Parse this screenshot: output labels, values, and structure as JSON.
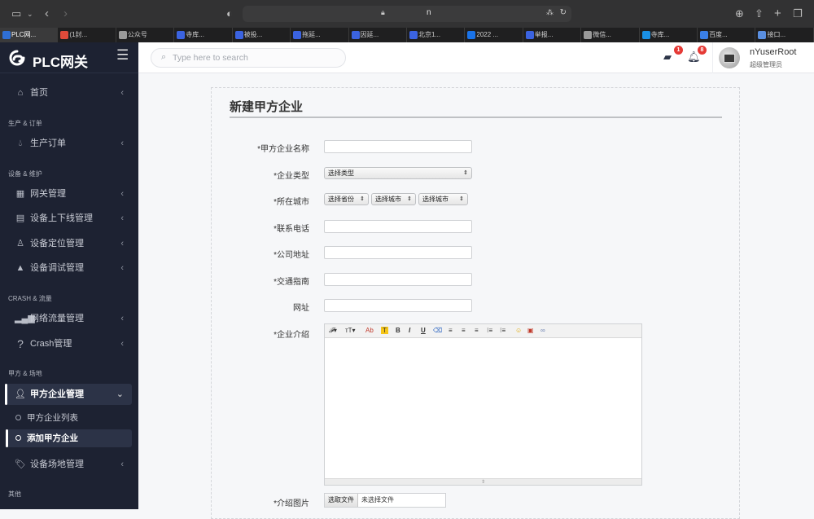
{
  "browser": {
    "url_text": "n",
    "tabs": [
      {
        "label": "PLC网...",
        "color": "#2f6fd6",
        "active": true
      },
      {
        "label": "(1封...",
        "color": "#e04a3a"
      },
      {
        "label": "公众号",
        "color": "#9a9a9a"
      },
      {
        "label": "寺库...",
        "color": "#3b63e0"
      },
      {
        "label": "被投...",
        "color": "#3b63e0"
      },
      {
        "label": "拖延...",
        "color": "#3b63e0"
      },
      {
        "label": "因延...",
        "color": "#3b63e0"
      },
      {
        "label": "北京1...",
        "color": "#3b63e0"
      },
      {
        "label": "2022 ...",
        "color": "#1a73e8"
      },
      {
        "label": "举报...",
        "color": "#3b63e0"
      },
      {
        "label": "微信...",
        "color": "#9a9a9a"
      },
      {
        "label": "寺库...",
        "color": "#1a8fe3"
      },
      {
        "label": "百度...",
        "color": "#3a7fe6"
      },
      {
        "label": "接口...",
        "color": "#5a8fe0"
      }
    ]
  },
  "sidebar": {
    "brand": "PLC网关",
    "sections": [
      {
        "title": "生产 & 订单"
      },
      {
        "title": "设备 & 维护"
      },
      {
        "title": "CRASH & 流量"
      },
      {
        "title": "甲方 & 场地"
      },
      {
        "title": "其他"
      }
    ],
    "items": [
      {
        "label": "首页",
        "icon": "home-icon"
      },
      {
        "label": "生产订单",
        "icon": "droplet-icon"
      },
      {
        "label": "网关管理",
        "icon": "grid-icon"
      },
      {
        "label": "设备上下线管理",
        "icon": "device-icon"
      },
      {
        "label": "设备定位管理",
        "icon": "location-user-icon"
      },
      {
        "label": "设备调试管理",
        "icon": "warning-icon"
      },
      {
        "label": "网络流量管理",
        "icon": "signal-bars-icon"
      },
      {
        "label": "Crash管理",
        "icon": "question-icon"
      },
      {
        "label": "甲方企业管理",
        "icon": "user-list-icon"
      },
      {
        "label": "设备场地管理",
        "icon": "tag-icon"
      }
    ],
    "sub_items": [
      {
        "label": "甲方企业列表"
      },
      {
        "label": "添加甲方企业",
        "active": true
      }
    ]
  },
  "topbar": {
    "search_placeholder": "Type here to search",
    "messages_count": "1",
    "notifications_count": "8",
    "user_name": "nYuserRoot",
    "user_role": "超级管理员"
  },
  "form": {
    "title": "新建甲方企业",
    "fields": {
      "name": {
        "label": "*甲方企业名称",
        "value": ""
      },
      "type": {
        "label": "*企业类型",
        "selected": "选择类型"
      },
      "city": {
        "label": "*所在城市",
        "province": "选择省份",
        "city": "选择城市",
        "district": "选择城市"
      },
      "phone": {
        "label": "*联系电话",
        "value": ""
      },
      "address": {
        "label": "*公司地址",
        "value": ""
      },
      "traffic": {
        "label": "*交通指南",
        "value": ""
      },
      "website": {
        "label": "网址",
        "value": ""
      },
      "intro": {
        "label": "*企业介绍",
        "value": ""
      },
      "image": {
        "label": "*介绍图片",
        "button": "选取文件",
        "filename": "未选择文件"
      }
    },
    "editor_toolbar": {
      "font": "𝓕▾",
      "size": "тT▾",
      "color": "Ab",
      "highlight": "T",
      "bold": "B",
      "italic": "I",
      "underline": "U",
      "eraser": "⌫",
      "align_left": "≡",
      "align_center": "≡",
      "align_right": "≡",
      "ordered_list": "⁝≡",
      "unordered_list": "⁝≡",
      "emoji": "☺",
      "image": "▣",
      "link": "∞",
      "resize": "⇕"
    }
  }
}
